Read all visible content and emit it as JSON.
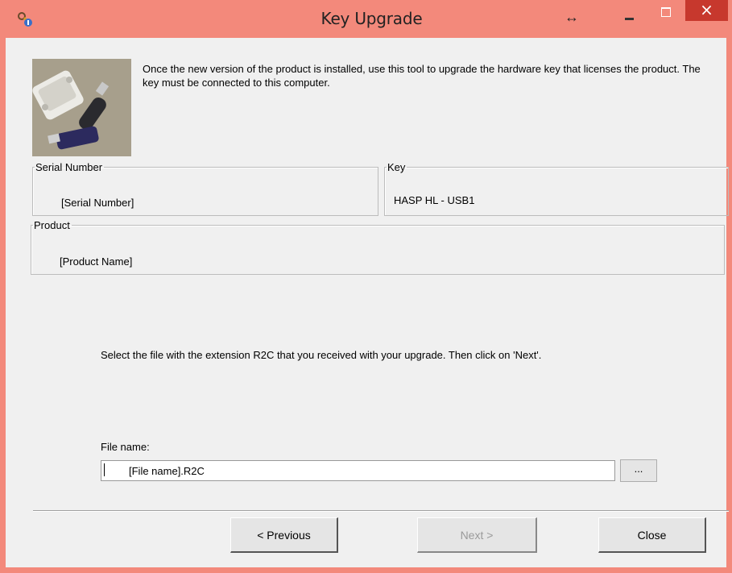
{
  "window": {
    "title": "Key Upgrade",
    "resize_glyph": "↔",
    "close_glyph": "×",
    "titlebar_color": "#f3897b",
    "close_color": "#c7382d"
  },
  "intro": {
    "text": "Once the new version of the product is installed, use this tool to upgrade the hardware key that licenses the product. The key must be connected to this computer."
  },
  "serial": {
    "legend": "Serial Number",
    "value": "[Serial Number]"
  },
  "key": {
    "legend": "Key",
    "value": "HASP HL - USB1"
  },
  "product": {
    "legend": "Product",
    "value": "[Product  Name]"
  },
  "instruction": "Select the file with the extension R2C that you received with your upgrade. Then click on 'Next'.",
  "file": {
    "label": "File name:",
    "value": "[File name].R2C",
    "browse_label": "..."
  },
  "buttons": {
    "previous": "< Previous",
    "next": "Next >",
    "close": "Close"
  }
}
